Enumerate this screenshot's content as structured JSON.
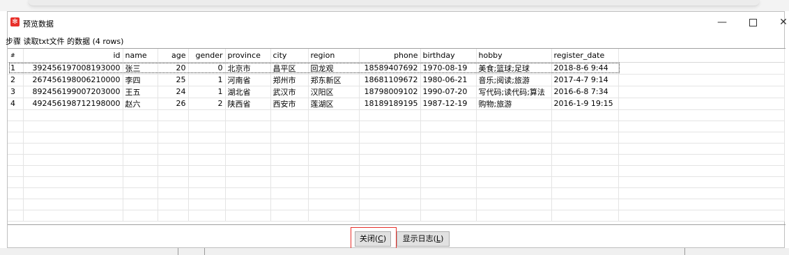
{
  "window": {
    "title": "预览数据",
    "app_icon_glyph": "✻",
    "minimize_glyph": "—",
    "close_glyph": "✕"
  },
  "step_label": "步骤 读取txt文件 的数据  (4 rows)",
  "table": {
    "rownum_header": "#",
    "columns": [
      "id",
      "name",
      "age",
      "gender",
      "province",
      "city",
      "region",
      "phone",
      "birthday",
      "hobby",
      "register_date"
    ],
    "rows": [
      [
        "1",
        "392456197008193000",
        "张三",
        "20",
        "0",
        "北京市",
        "昌平区",
        "回龙观",
        "18589407692",
        "1970-08-19",
        "美食;篮球;足球",
        "2018-8-6 9:44"
      ],
      [
        "2",
        "267456198006210000",
        "李四",
        "25",
        "1",
        "河南省",
        "郑州市",
        "郑东新区",
        "18681109672",
        "1980-06-21",
        "音乐;阅读;旅游",
        "2017-4-7 9:14"
      ],
      [
        "3",
        "892456199007203000",
        "王五",
        "24",
        "1",
        "湖北省",
        "武汉市",
        "汉阳区",
        "18798009102",
        "1990-07-20",
        "写代码;读代码;算法",
        "2016-6-8 7:34"
      ],
      [
        "4",
        "492456198712198000",
        "赵六",
        "26",
        "2",
        "陕西省",
        "西安市",
        "莲湖区",
        "18189189195",
        "1987-12-19",
        "购物;旅游",
        "2016-1-9 19:15"
      ]
    ]
  },
  "buttons": {
    "close_text": "关闭(",
    "close_key": "C",
    "close_end": ")",
    "log_text": "显示日志(",
    "log_key": "L",
    "log_end": ")"
  },
  "colors": {
    "accent_highlight": "#e8302a",
    "app_icon": "#e8302a"
  }
}
